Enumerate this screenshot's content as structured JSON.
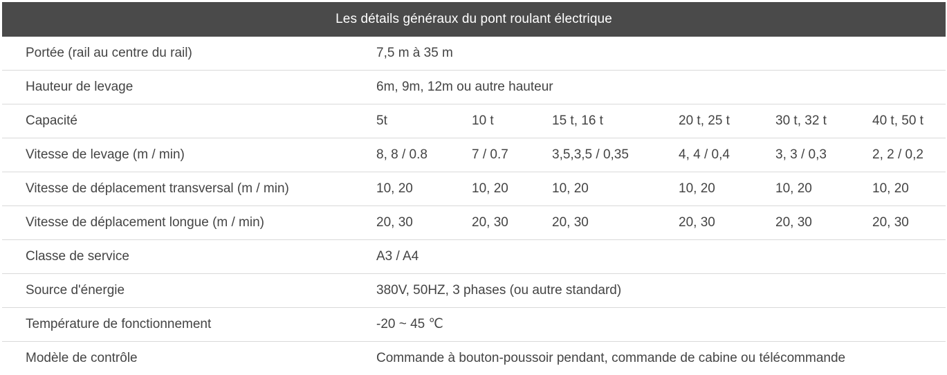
{
  "header": {
    "title": "Les détails généraux du pont roulant électrique"
  },
  "rows": {
    "portee": {
      "label": "Portée (rail au centre du rail)",
      "value": "7,5 m à 35 m"
    },
    "hauteur": {
      "label": "Hauteur de levage",
      "value": "6m, 9m, 12m ou autre hauteur"
    },
    "capacite": {
      "label": "Capacité",
      "values": [
        "5t",
        "10 t",
        "15 t, 16 t",
        "20 t, 25 t",
        "30 t, 32 t",
        "40 t, 50 t"
      ]
    },
    "vitesse_levage": {
      "label": "Vitesse de levage (m / min)",
      "values": [
        "8, 8 / 0.8",
        "7 / 0.7",
        "3,5,3,5 / 0,35",
        "4, 4 / 0,4",
        "3, 3 / 0,3",
        "2, 2 / 0,2"
      ]
    },
    "vitesse_transversal": {
      "label": "Vitesse de déplacement transversal (m / min)",
      "values": [
        "10, 20",
        "10, 20",
        "10, 20",
        "10, 20",
        "10, 20",
        "10, 20"
      ]
    },
    "vitesse_longue": {
      "label": "Vitesse de déplacement longue (m / min)",
      "values": [
        "20, 30",
        "20, 30",
        "20, 30",
        "20, 30",
        "20, 30",
        "20, 30"
      ]
    },
    "classe": {
      "label": "Classe de service",
      "value": "A3 / A4"
    },
    "source": {
      "label": "Source d'énergie",
      "value": "380V, 50HZ, 3 phases (ou autre standard)"
    },
    "temperature": {
      "label": "Température de fonctionnement",
      "value": "-20 ~ 45 ℃"
    },
    "modele": {
      "label": "Modèle de contrôle",
      "value": "Commande à bouton-poussoir pendant, commande de cabine ou télécommande"
    }
  },
  "colors": {
    "header_background": "#4a4a4a",
    "header_text": "#ffffff",
    "body_text": "#444444",
    "row_divider": "#d9d9d9"
  }
}
